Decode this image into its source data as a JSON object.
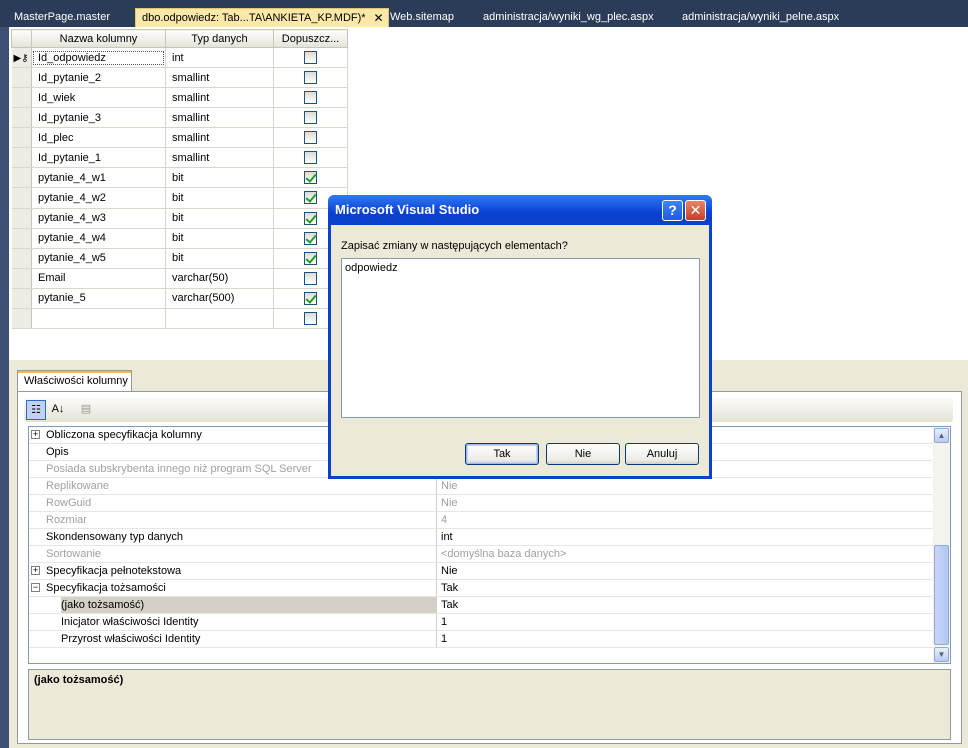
{
  "tabs": [
    {
      "label": "MasterPage.master",
      "active": false
    },
    {
      "label": "dbo.odpowiedz: Tab...TA\\ANKIETA_KP.MDF)*",
      "active": true
    },
    {
      "label": "Web.sitemap",
      "active": false
    },
    {
      "label": "administracja/wyniki_wg_plec.aspx",
      "active": false
    },
    {
      "label": "administracja/wyniki_pelne.aspx",
      "active": false
    }
  ],
  "tab_close_glyph": "✕",
  "grid": {
    "headers": [
      "Nazwa kolumny",
      "Typ danych",
      "Dopuszcz..."
    ],
    "rows": [
      {
        "name": "Id_odpowiedz",
        "type": "int",
        "nullable": false
      },
      {
        "name": "Id_pytanie_2",
        "type": "smallint",
        "nullable": false
      },
      {
        "name": "Id_wiek",
        "type": "smallint",
        "nullable": false
      },
      {
        "name": "Id_pytanie_3",
        "type": "smallint",
        "nullable": false
      },
      {
        "name": "Id_plec",
        "type": "smallint",
        "nullable": false
      },
      {
        "name": "Id_pytanie_1",
        "type": "smallint",
        "nullable": false
      },
      {
        "name": "pytanie_4_w1",
        "type": "bit",
        "nullable": true
      },
      {
        "name": "pytanie_4_w2",
        "type": "bit",
        "nullable": true
      },
      {
        "name": "pytanie_4_w3",
        "type": "bit",
        "nullable": true
      },
      {
        "name": "pytanie_4_w4",
        "type": "bit",
        "nullable": true
      },
      {
        "name": "pytanie_4_w5",
        "type": "bit",
        "nullable": true
      },
      {
        "name": "Email",
        "type": "varchar(50)",
        "nullable": false
      },
      {
        "name": "pytanie_5",
        "type": "varchar(500)",
        "nullable": true
      },
      {
        "name": "",
        "type": "",
        "nullable": false
      }
    ]
  },
  "properties": {
    "tab_label": "Właściwości kolumny",
    "rows": [
      {
        "name": "Obliczona specyfikacja kolumny",
        "value": "",
        "expander": "+",
        "disabled": false,
        "indent": false
      },
      {
        "name": "Opis",
        "value": "",
        "expander": "",
        "disabled": false,
        "indent": false
      },
      {
        "name": "Posiada subskrybenta innego niż program SQL Server",
        "value": "",
        "expander": "",
        "disabled": true,
        "indent": false
      },
      {
        "name": "Replikowane",
        "value": "Nie",
        "expander": "",
        "disabled": true,
        "indent": false
      },
      {
        "name": "RowGuid",
        "value": "Nie",
        "expander": "",
        "disabled": true,
        "indent": false
      },
      {
        "name": "Rozmiar",
        "value": "4",
        "expander": "",
        "disabled": true,
        "indent": false
      },
      {
        "name": "Skondensowany typ danych",
        "value": "int",
        "expander": "",
        "disabled": false,
        "indent": false
      },
      {
        "name": "Sortowanie",
        "value": "<domyślna baza danych>",
        "expander": "",
        "disabled": true,
        "indent": false
      },
      {
        "name": "Specyfikacja pełnotekstowa",
        "value": "Nie",
        "expander": "+",
        "disabled": false,
        "indent": false
      },
      {
        "name": "Specyfikacja tożsamości",
        "value": "Tak",
        "expander": "−",
        "disabled": false,
        "indent": false
      },
      {
        "name": "(jako tożsamość)",
        "value": "Tak",
        "expander": "",
        "disabled": false,
        "indent": true,
        "selected": true
      },
      {
        "name": "Inicjator właściwości Identity",
        "value": "1",
        "expander": "",
        "disabled": false,
        "indent": true
      },
      {
        "name": "Przyrost właściwości Identity",
        "value": "1",
        "expander": "",
        "disabled": false,
        "indent": true
      }
    ],
    "description_title": "(jako tożsamość)"
  },
  "dialog": {
    "title": "Microsoft Visual Studio",
    "help_glyph": "?",
    "close_glyph": "✕",
    "prompt": "Zapisać zmiany w następujących elementach?",
    "items": [
      "odpowiedz"
    ],
    "buttons": {
      "yes": "Tak",
      "no": "Nie",
      "cancel": "Anuluj"
    }
  }
}
